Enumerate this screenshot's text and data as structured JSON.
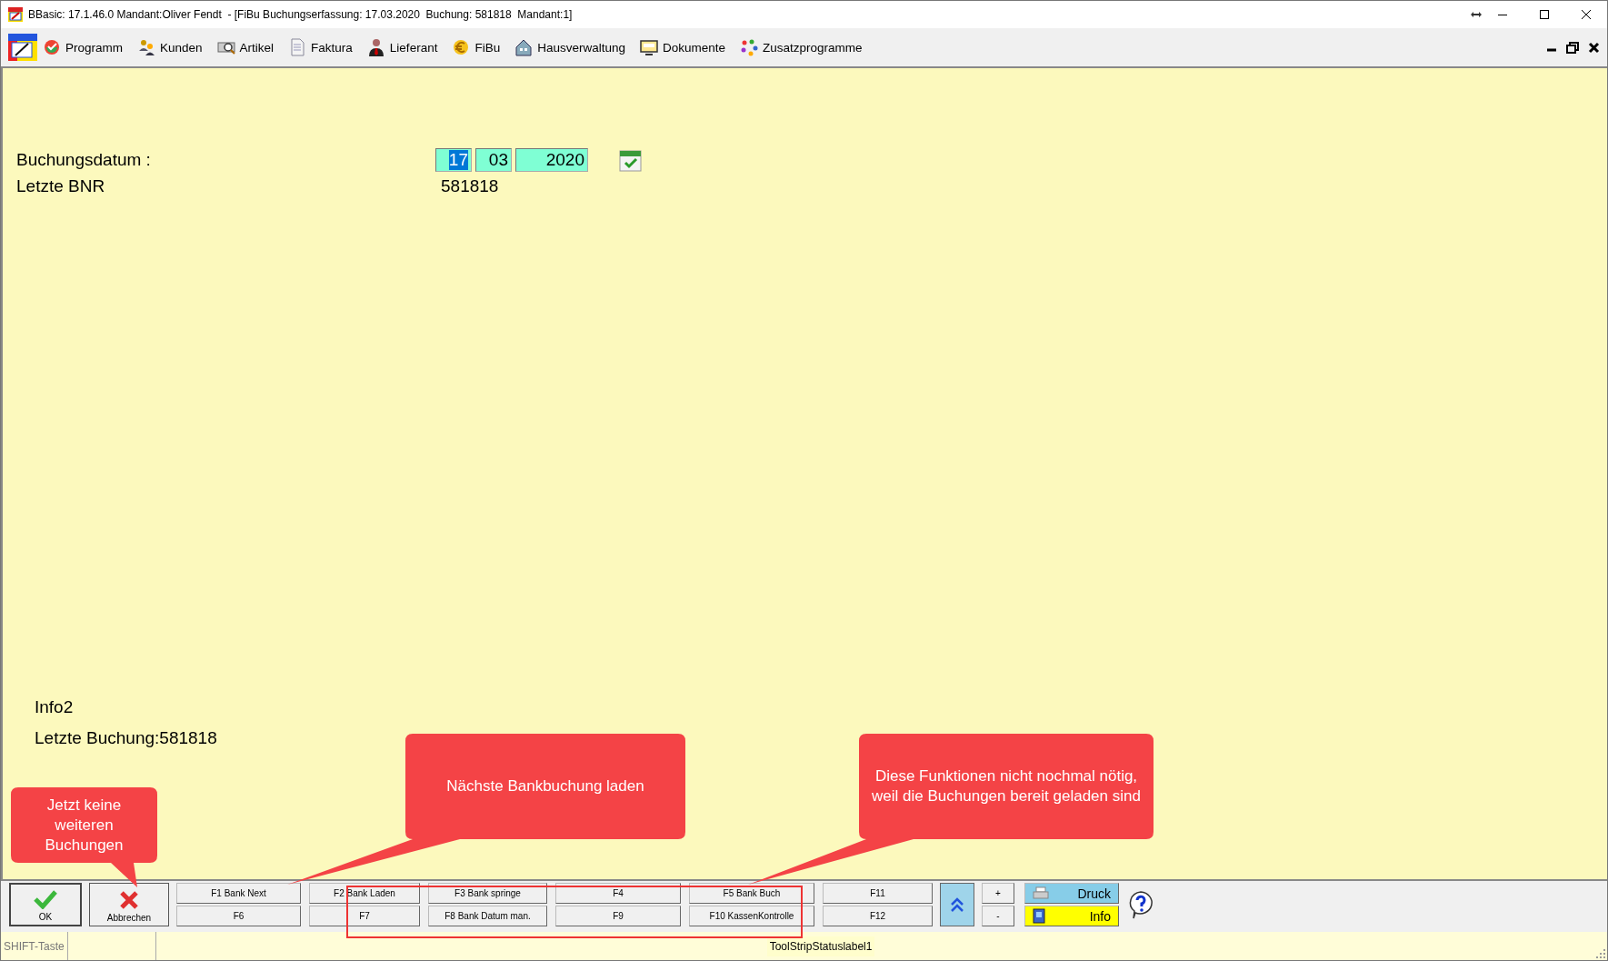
{
  "window": {
    "title": "BBasic: 17.1.46.0 Mandant:Oliver Fendt  - [FiBu Buchungserfassung: 17.03.2020  Buchung: 581818  Mandant:1]"
  },
  "menu": [
    {
      "label": "Programm"
    },
    {
      "label": "Kunden"
    },
    {
      "label": "Artikel"
    },
    {
      "label": "Faktura"
    },
    {
      "label": "Lieferant"
    },
    {
      "label": "FiBu"
    },
    {
      "label": "Hausverwaltung"
    },
    {
      "label": "Dokumente"
    },
    {
      "label": "Zusatzprogramme"
    }
  ],
  "form": {
    "date_label": "Buchungsdatum :",
    "date_fields": [
      {
        "value": "17",
        "selected": true
      },
      {
        "value": "03",
        "selected": false
      },
      {
        "value": "2020",
        "selected": false
      }
    ],
    "last_bnr_label": "Letzte BNR",
    "last_bnr": "581818"
  },
  "info": {
    "title": "Info2",
    "last_booking": "Letzte Buchung:581818"
  },
  "callouts": [
    {
      "text": "Jetzt keine weiteren Buchungen"
    },
    {
      "text": "Nächste Bankbuchung laden"
    },
    {
      "text": "Diese Funktionen nicht nochmal nötig, weil die Buchungen bereit geladen sind"
    }
  ],
  "toolbar": {
    "ok": "OK",
    "cancel": "Abbrechen",
    "function_keys": [
      {
        "top": "F1 Bank Next",
        "bottom": "F6"
      },
      {
        "top": "F2 Bank Laden",
        "bottom": "F7"
      },
      {
        "top": "F3 Bank springe",
        "bottom": "F8 Bank Datum man."
      },
      {
        "top": "F4",
        "bottom": "F9"
      },
      {
        "top": "F5 Bank Buch",
        "bottom": "F10 KassenKontrolle"
      },
      {
        "top": "F11",
        "bottom": "F12"
      }
    ],
    "plus": "+",
    "minus": "-",
    "print": "Druck",
    "info": "Info"
  },
  "status_bar": {
    "shift": "SHIFT-Taste",
    "label": "ToolStripStatuslabel1"
  }
}
